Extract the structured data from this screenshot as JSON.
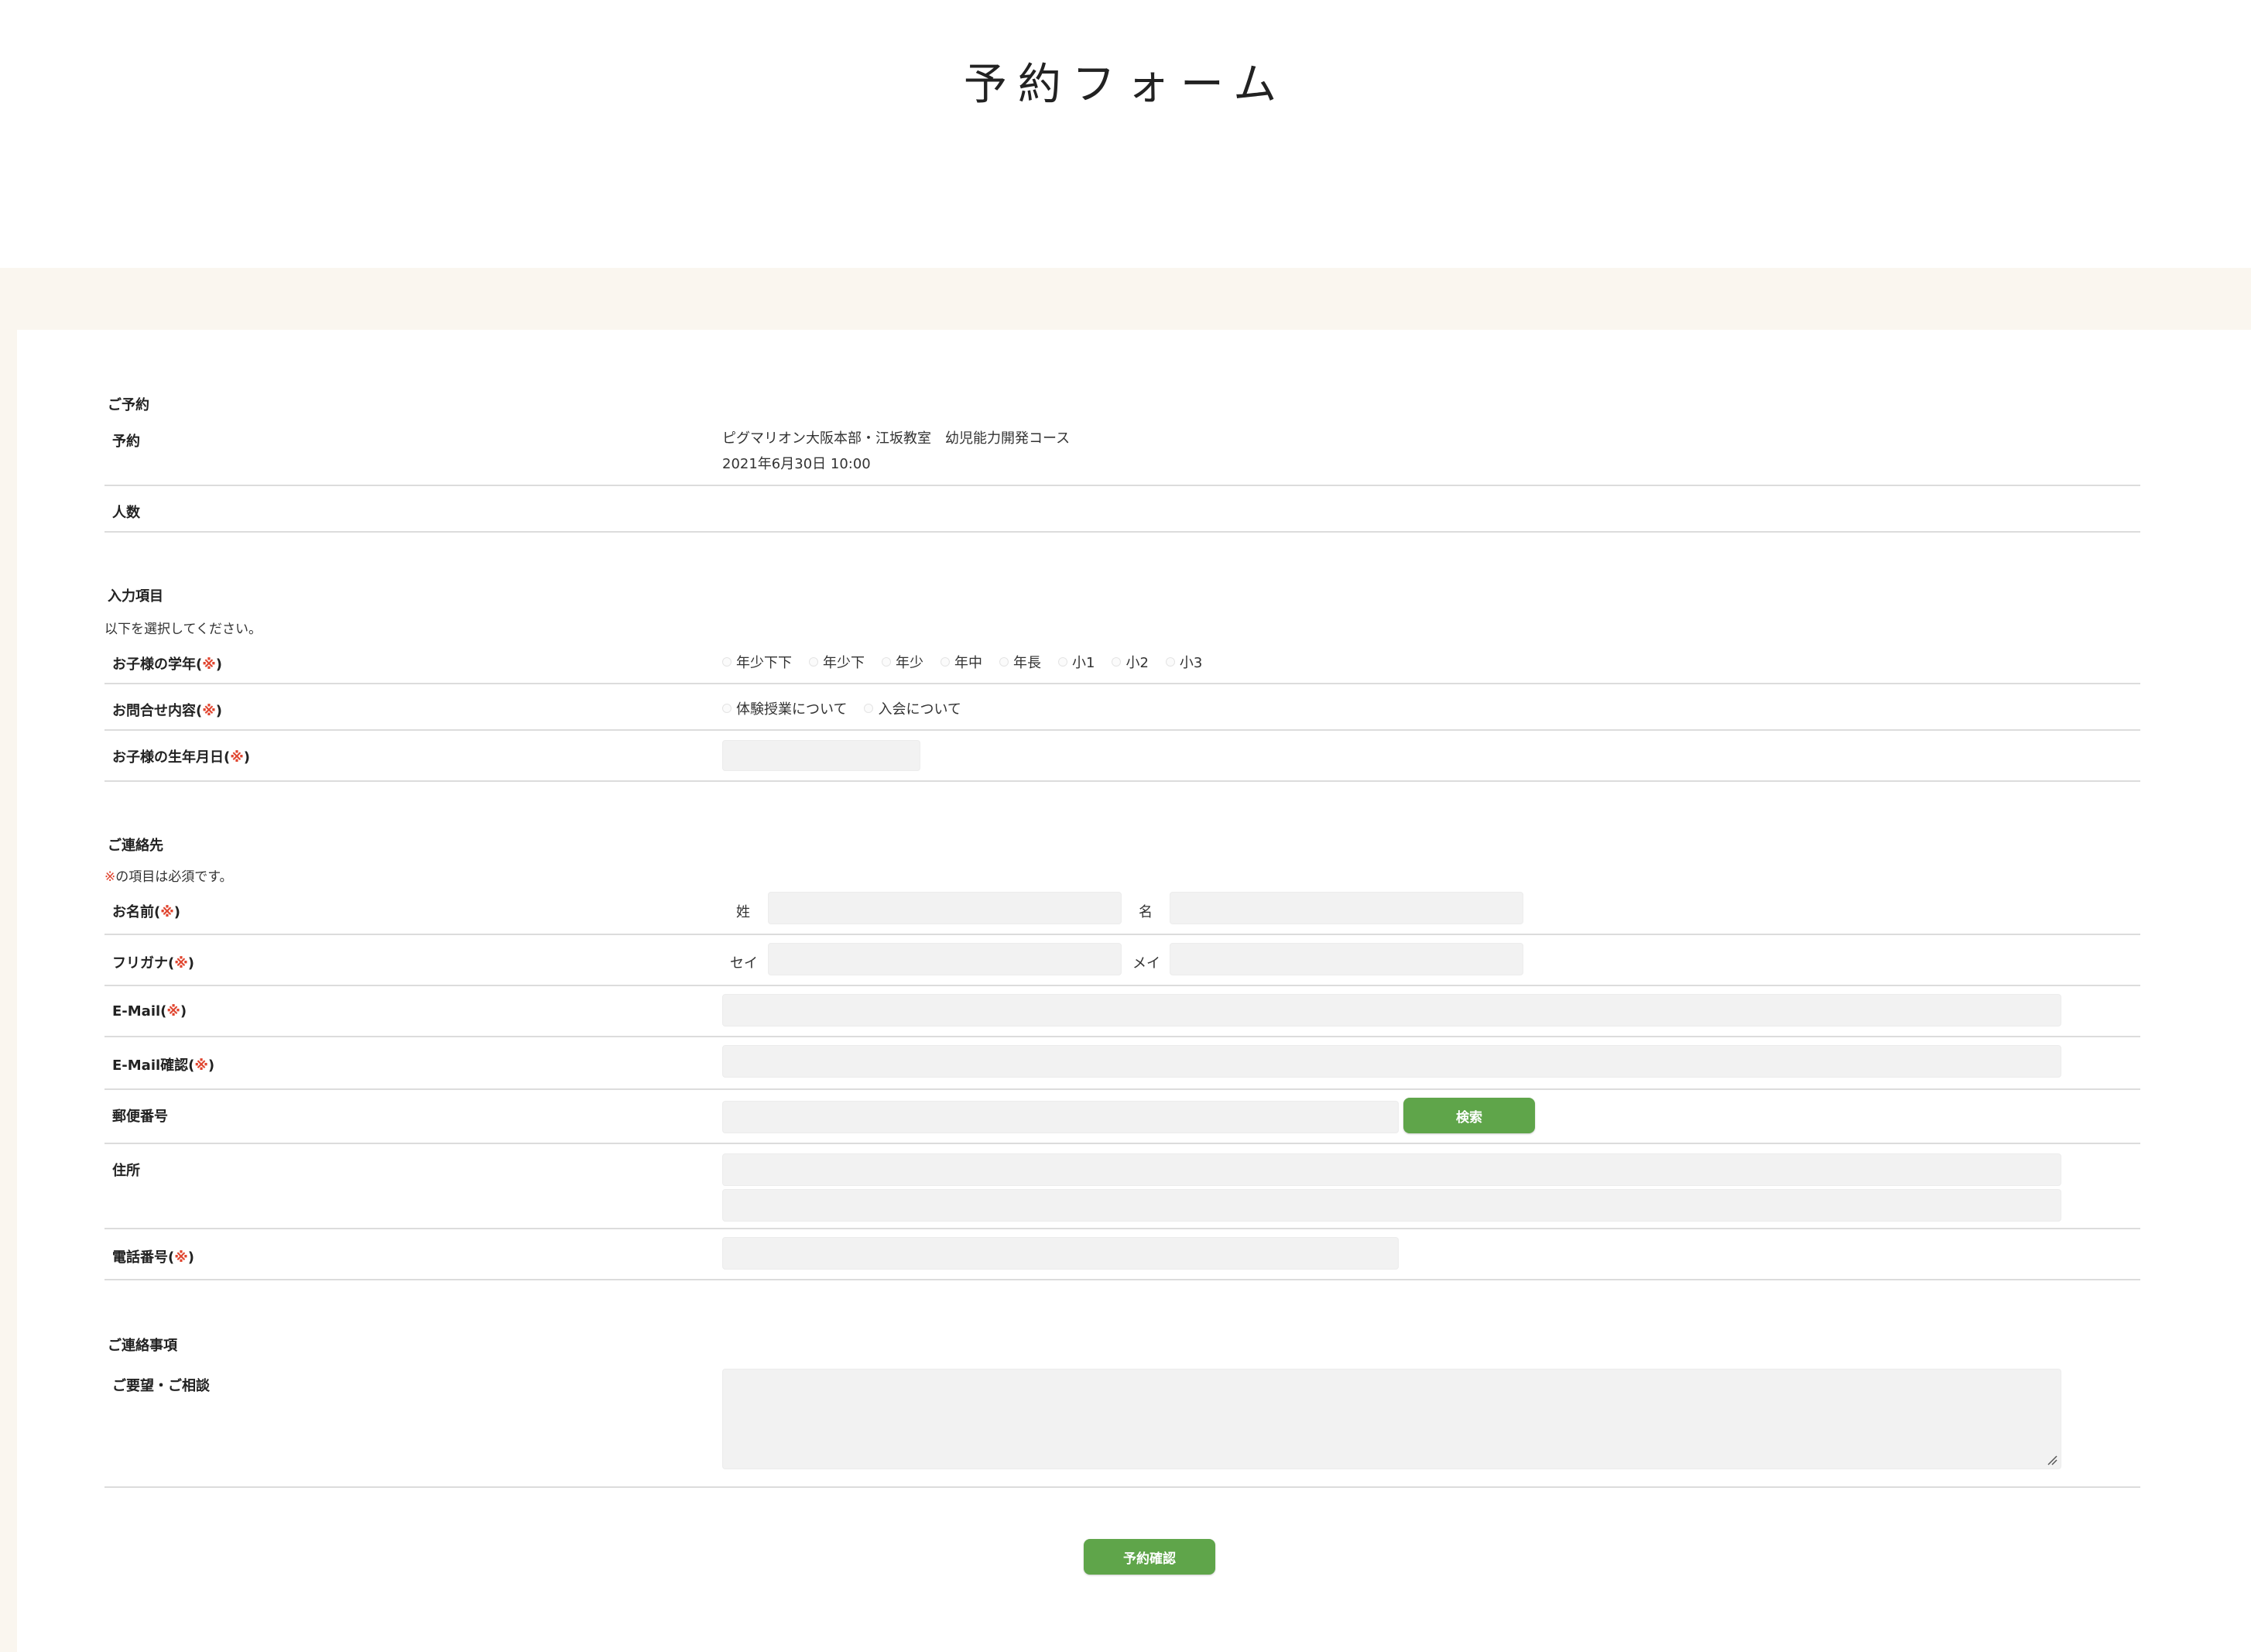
{
  "page": {
    "title": "予約フォーム"
  },
  "required_mark": "※",
  "reservation": {
    "section_title": "ご予約",
    "rows": {
      "reservation_label": "予約",
      "reservation_line1": "ピグマリオン大阪本部・江坂教室　幼児能力開発コース",
      "reservation_line2": "2021年6月30日 10:00",
      "people_label": "人数"
    }
  },
  "input_items": {
    "section_title": "入力項目",
    "note": "以下を選択してください。",
    "grade_label": "お子様の学年",
    "grade_options": [
      "年少下下",
      "年少下",
      "年少",
      "年中",
      "年長",
      "小1",
      "小2",
      "小3"
    ],
    "inquiry_label": "お問合せ内容",
    "inquiry_options": [
      "体験授業について",
      "入会について"
    ],
    "birthdate_label": "お子様の生年月日",
    "birthdate_value": ""
  },
  "contact": {
    "section_title": "ご連絡先",
    "note_suffix": "の項目は必須です。",
    "name_label": "お名前",
    "last_name_label": "姓",
    "first_name_label": "名",
    "last_name_value": "",
    "first_name_value": "",
    "kana_label": "フリガナ",
    "last_kana_label": "セイ",
    "first_kana_label": "メイ",
    "last_kana_value": "",
    "first_kana_value": "",
    "email_label": "E-Mail",
    "email_value": "",
    "email_confirm_label": "E-Mail確認",
    "email_confirm_value": "",
    "postal_label": "郵便番号",
    "postal_value": "",
    "search_button": "検索",
    "address_label": "住所",
    "address1_value": "",
    "address2_value": "",
    "phone_label": "電話番号",
    "phone_value": ""
  },
  "notes": {
    "section_title": "ご連絡事項",
    "request_label": "ご要望・ご相談",
    "request_value": ""
  },
  "submit_button": "予約確認",
  "colors": {
    "accent_green": "#5fa54a",
    "required_red": "#e0442e",
    "page_background": "#faf6ef",
    "field_background": "#f2f2f2"
  }
}
